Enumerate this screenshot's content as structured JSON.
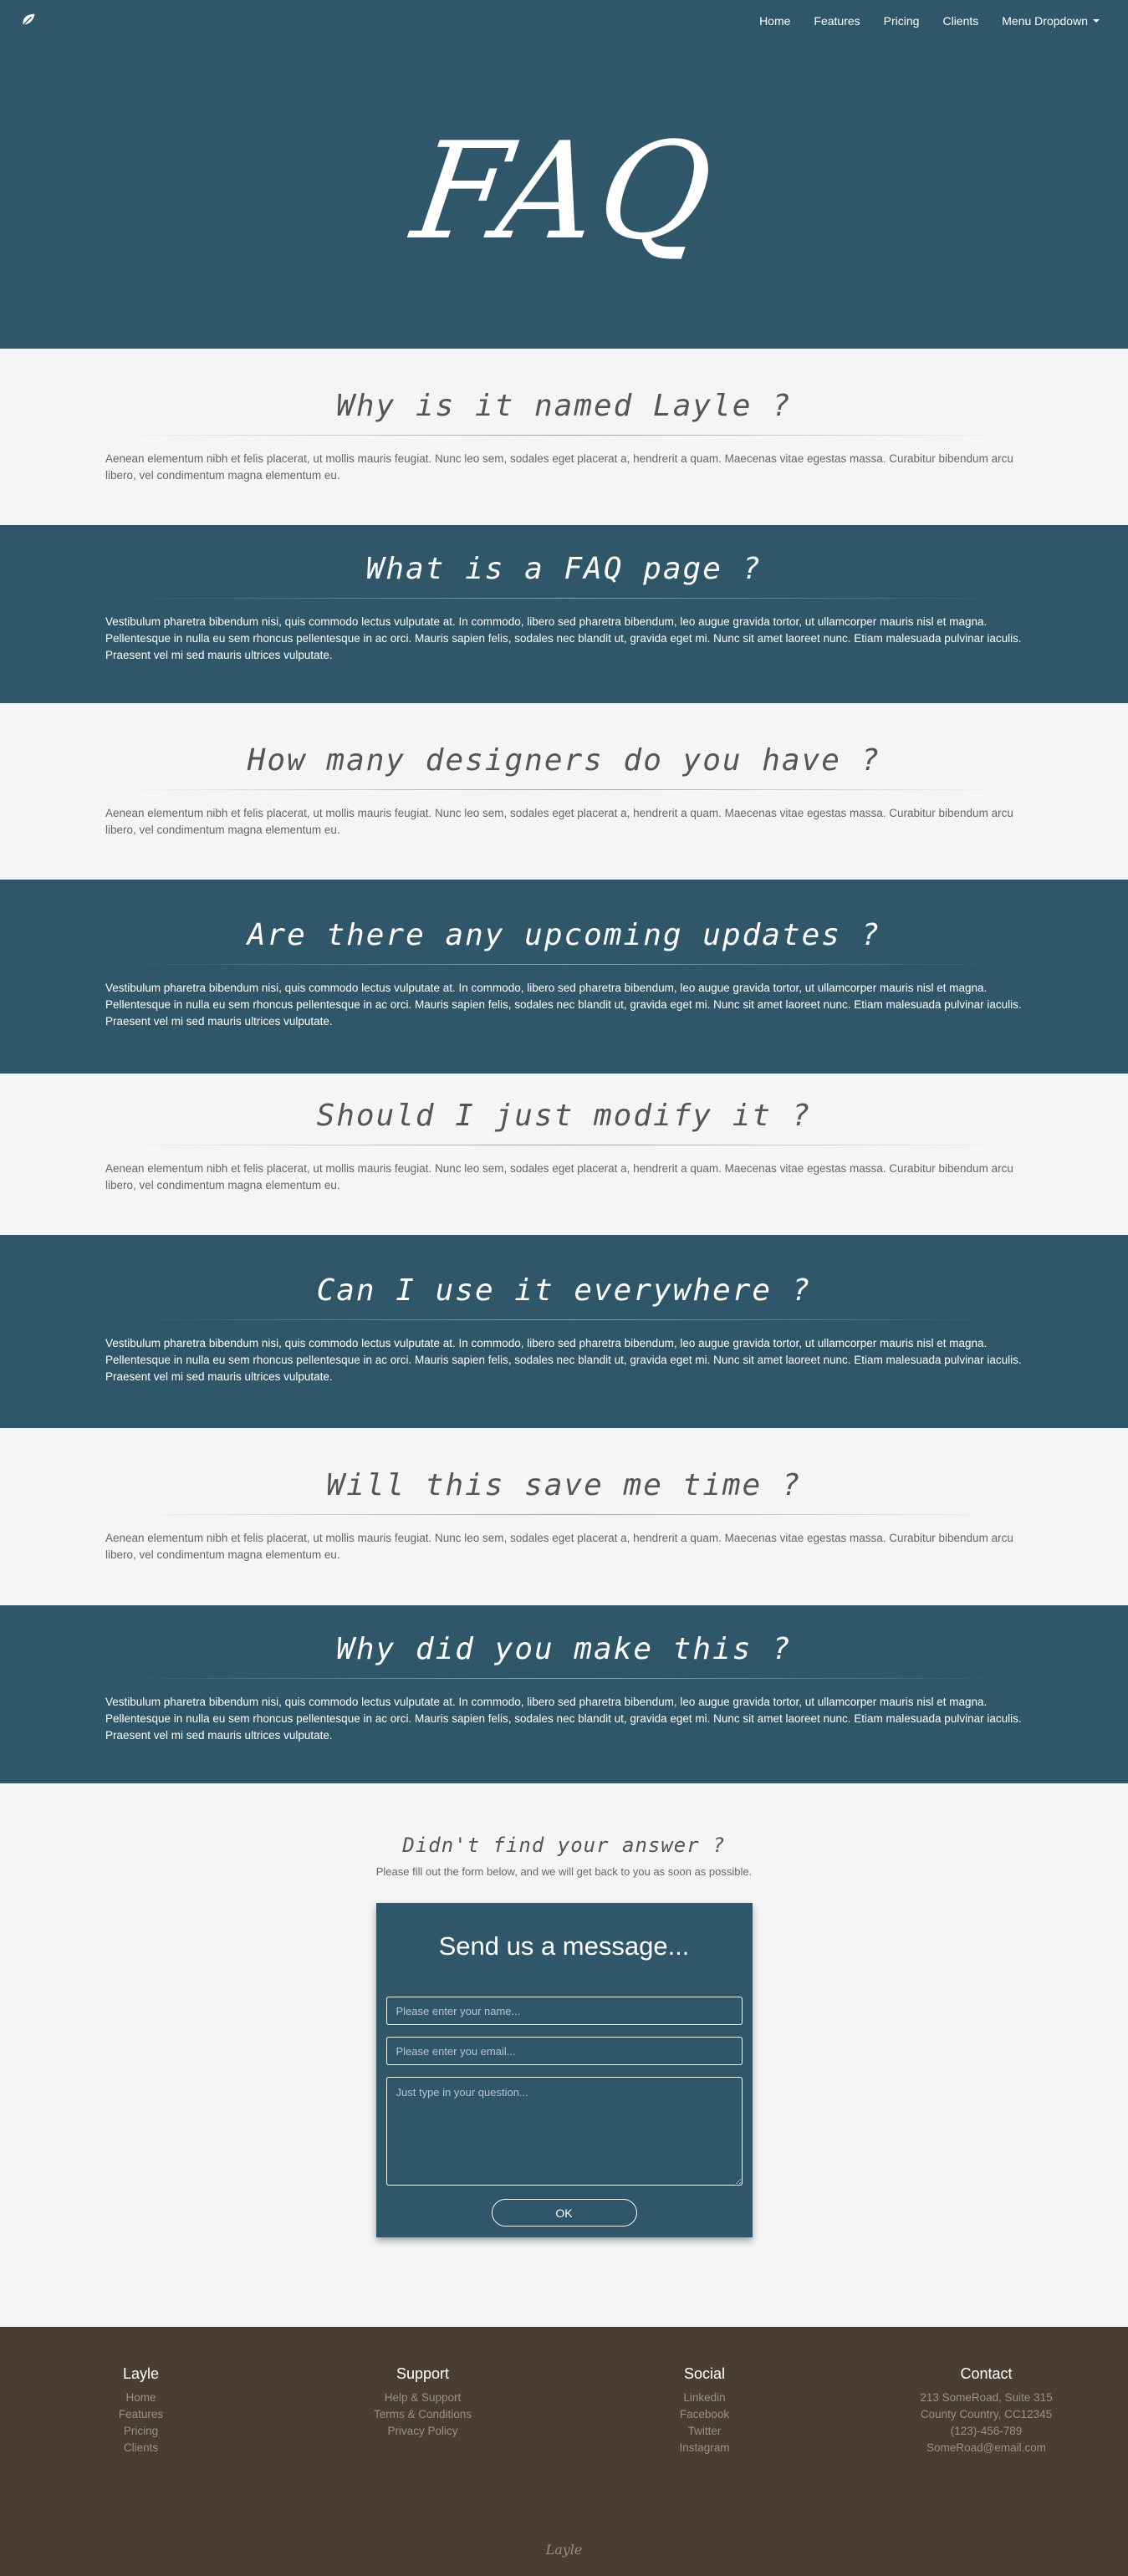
{
  "nav": {
    "links": [
      "Home",
      "Features",
      "Pricing",
      "Clients"
    ],
    "dropdown_label": "Menu Dropdown"
  },
  "hero": {
    "title": "FAQ"
  },
  "faqs": [
    {
      "question": "Why is it named Layle ?",
      "answer": "Aenean elementum nibh et felis placerat, ut mollis mauris feugiat. Nunc leo sem, sodales eget placerat a, hendrerit a quam. Maecenas vitae egestas massa. Curabitur bibendum arcu libero, vel condimentum magna elementum eu."
    },
    {
      "question": "What is a FAQ page ?",
      "answer": "Vestibulum pharetra bibendum nisi, quis commodo lectus vulputate at. In commodo, libero sed pharetra bibendum, leo augue gravida tortor, ut ullamcorper mauris nisl et magna. Pellentesque in nulla eu sem rhoncus pellentesque in ac orci. Mauris sapien felis, sodales nec blandit ut, gravida eget mi. Nunc sit amet laoreet nunc. Etiam malesuada pulvinar iaculis. Praesent vel mi sed mauris ultrices vulputate."
    },
    {
      "question": "How many designers do you have ?",
      "answer": "Aenean elementum nibh et felis placerat, ut mollis mauris feugiat. Nunc leo sem, sodales eget placerat a, hendrerit a quam. Maecenas vitae egestas massa. Curabitur bibendum arcu libero, vel condimentum magna elementum eu."
    },
    {
      "question": "Are there any upcoming updates ?",
      "answer": "Vestibulum pharetra bibendum nisi, quis commodo lectus vulputate at. In commodo, libero sed pharetra bibendum, leo augue gravida tortor, ut ullamcorper mauris nisl et magna. Pellentesque in nulla eu sem rhoncus pellentesque in ac orci. Mauris sapien felis, sodales nec blandit ut, gravida eget mi. Nunc sit amet laoreet nunc. Etiam malesuada pulvinar iaculis. Praesent vel mi sed mauris ultrices vulputate."
    },
    {
      "question": "Should I just modify it ?",
      "answer": "Aenean elementum nibh et felis placerat, ut mollis mauris feugiat. Nunc leo sem, sodales eget placerat a, hendrerit a quam. Maecenas vitae egestas massa. Curabitur bibendum arcu libero, vel condimentum magna elementum eu."
    },
    {
      "question": "Can I use it everywhere ?",
      "answer": "Vestibulum pharetra bibendum nisi, quis commodo lectus vulputate at. In commodo, libero sed pharetra bibendum, leo augue gravida tortor, ut ullamcorper mauris nisl et magna. Pellentesque in nulla eu sem rhoncus pellentesque in ac orci. Mauris sapien felis, sodales nec blandit ut, gravida eget mi. Nunc sit amet laoreet nunc. Etiam malesuada pulvinar iaculis. Praesent vel mi sed mauris ultrices vulputate."
    },
    {
      "question": "Will this save me time ?",
      "answer": "Aenean elementum nibh et felis placerat, ut mollis mauris feugiat. Nunc leo sem, sodales eget placerat a, hendrerit a quam. Maecenas vitae egestas massa. Curabitur bibendum arcu libero, vel condimentum magna elementum eu."
    },
    {
      "question": "Why did you make this ?",
      "answer": "Vestibulum pharetra bibendum nisi, quis commodo lectus vulputate at. In commodo, libero sed pharetra bibendum, leo augue gravida tortor, ut ullamcorper mauris nisl et magna. Pellentesque in nulla eu sem rhoncus pellentesque in ac orci. Mauris sapien felis, sodales nec blandit ut, gravida eget mi. Nunc sit amet laoreet nunc. Etiam malesuada pulvinar iaculis. Praesent vel mi sed mauris ultrices vulputate."
    }
  ],
  "contact": {
    "heading": "Didn't find your answer ?",
    "subtext": "Please fill out the form below, and we will get back to you as soon as possible.",
    "form_title": "Send us a message...",
    "name_placeholder": "Please enter your name...",
    "email_placeholder": "Please enter you email...",
    "question_placeholder": "Just type in your question...",
    "submit_label": "OK"
  },
  "footer": {
    "columns": [
      {
        "title": "Layle",
        "items": [
          "Home",
          "Features",
          "Pricing",
          "Clients"
        ]
      },
      {
        "title": "Support",
        "items": [
          "Help & Support",
          "Terms & Conditions",
          "Privacy Policy"
        ]
      },
      {
        "title": "Social",
        "items": [
          "Linkedin",
          "Facebook",
          "Twitter",
          "Instagram"
        ]
      },
      {
        "title": "Contact",
        "items": [
          "213 SomeRoad, Suite 315",
          "County Country, CC12345",
          "(123)-456-789",
          "SomeRoad@email.com"
        ]
      }
    ],
    "brand": "Layle"
  },
  "colors": {
    "primary": "#2f5769",
    "light_bg": "#f4f5f7",
    "footer_bg": "#4a3e33",
    "footer_text": "#9a9088"
  },
  "icons": {
    "logo": "leaf-icon",
    "dropdown": "caret-down-icon"
  }
}
